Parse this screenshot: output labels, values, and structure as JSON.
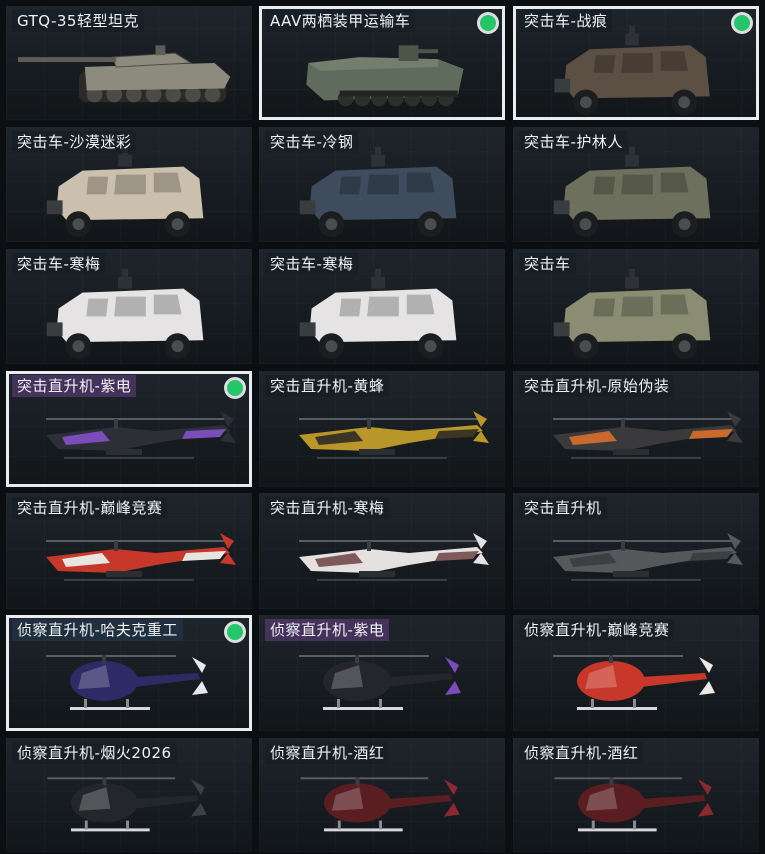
{
  "colors": {
    "accent": "#25c56a",
    "selected_border": "#e9ecef"
  },
  "cards": [
    {
      "label": "GTQ-35轻型坦克",
      "kind": "tank",
      "camo": "#8d8b7e",
      "selected": false,
      "badge": false
    },
    {
      "label": "AAV两栖装甲运输车",
      "kind": "aav",
      "camo": "#5f6b5c",
      "selected": true,
      "badge": true
    },
    {
      "label": "突击车-战痕",
      "kind": "truck",
      "camo": "#5c4f44",
      "selected": true,
      "badge": true
    },
    {
      "label": "突击车-沙漠迷彩",
      "kind": "truck",
      "camo": "#cbbfae",
      "selected": false,
      "badge": false
    },
    {
      "label": "突击车-冷钢",
      "kind": "truck",
      "camo": "#3e4c5e",
      "selected": false,
      "badge": false
    },
    {
      "label": "突击车-护林人",
      "kind": "truck",
      "camo": "#6e705e",
      "selected": false,
      "badge": false
    },
    {
      "label": "突击车-寒梅",
      "kind": "truck",
      "camo": "#e5e3e3",
      "selected": false,
      "badge": false
    },
    {
      "label": "突击车-寒梅",
      "kind": "truck",
      "camo": "#e5e3e3",
      "selected": false,
      "badge": false
    },
    {
      "label": "突击车",
      "kind": "truck",
      "camo": "#8a8d72",
      "selected": false,
      "badge": false
    },
    {
      "label": "突击直升机-紫电",
      "kind": "heli",
      "camo": "#2c2f36",
      "accent": "#7a4dbb",
      "selected": true,
      "badge": true,
      "tag": "purple"
    },
    {
      "label": "突击直升机-黄蜂",
      "kind": "heli",
      "camo": "#b8962a",
      "accent": "#3a3524",
      "selected": false,
      "badge": false
    },
    {
      "label": "突击直升机-原始伪装",
      "kind": "heli",
      "camo": "#3a3a3c",
      "accent": "#c96a2c",
      "selected": false,
      "badge": false
    },
    {
      "label": "突击直升机-巅峰竞赛",
      "kind": "heli",
      "camo": "#c8382a",
      "accent": "#e8e4e0",
      "selected": false,
      "badge": false
    },
    {
      "label": "突击直升机-寒梅",
      "kind": "heli",
      "camo": "#e4e1e0",
      "accent": "#7e5a5a",
      "selected": false,
      "badge": false
    },
    {
      "label": "突击直升机",
      "kind": "heli",
      "camo": "#56595c",
      "accent": "#3d4043",
      "selected": false,
      "badge": false
    },
    {
      "label": "侦察直升机-哈夫克重工",
      "kind": "scout",
      "camo": "#2d2a66",
      "accent": "#e6e6ef",
      "selected": true,
      "badge": true,
      "tag": "blue"
    },
    {
      "label": "侦察直升机-紫电",
      "kind": "scout",
      "camo": "#25262c",
      "accent": "#7a4dbb",
      "selected": false,
      "badge": false,
      "tag": "purple"
    },
    {
      "label": "侦察直升机-巅峰竞赛",
      "kind": "scout",
      "camo": "#c8382a",
      "accent": "#ece8e4",
      "selected": false,
      "badge": false
    },
    {
      "label": "侦察直升机-烟火2026",
      "kind": "scout",
      "camo": "#23262b",
      "accent": "#3c4046",
      "selected": false,
      "badge": false
    },
    {
      "label": "侦察直升机-酒红",
      "kind": "scout",
      "camo": "#5a1e22",
      "accent": "#8a2a30",
      "selected": false,
      "badge": false
    },
    {
      "label": "侦察直升机-酒红",
      "kind": "scout",
      "camo": "#5a1e22",
      "accent": "#8a2a30",
      "selected": false,
      "badge": false
    }
  ]
}
